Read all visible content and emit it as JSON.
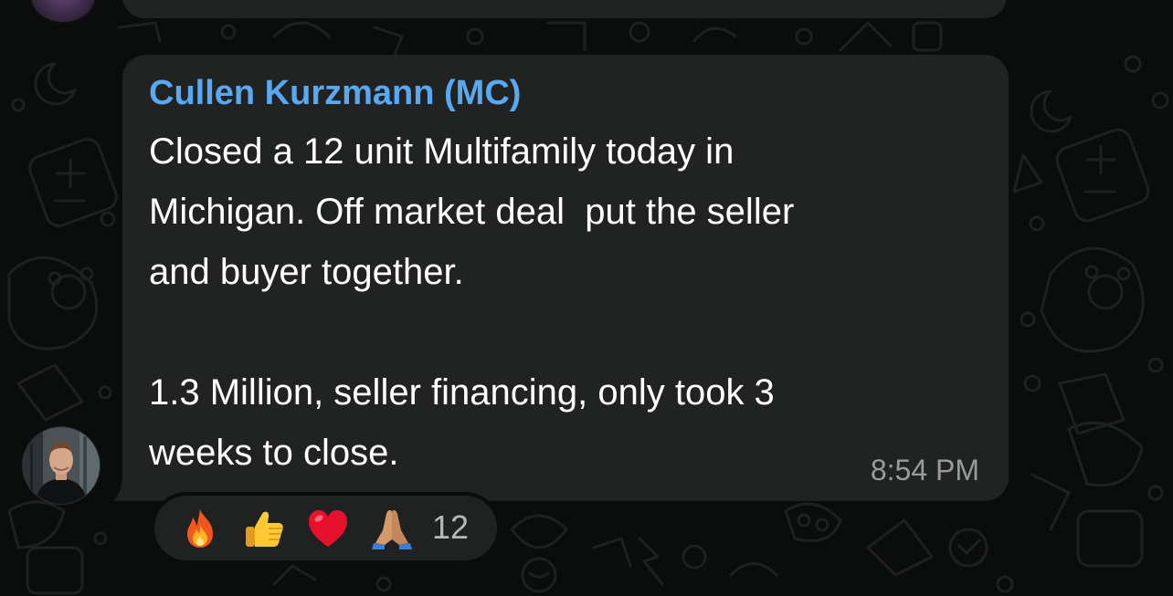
{
  "message": {
    "sender": "Cullen Kurzmann (MC)",
    "text": "Closed a 12 unit Multifamily today in\nMichigan. Off market deal  put the seller\nand buyer together.\n\n1.3 Million, seller financing, only took 3\nweeks to close.",
    "time": "8:54 PM"
  },
  "reactions": {
    "emojis": [
      "fire-emoji",
      "thumbs-up-emoji",
      "red-heart-emoji",
      "folded-hands-emoji"
    ],
    "count": "12"
  },
  "colors": {
    "background": "#0b0c0c",
    "bubble": "#212222",
    "sender_name": "#59a8f2",
    "message_text": "#ffffff",
    "timestamp": "#9a9c9c"
  }
}
